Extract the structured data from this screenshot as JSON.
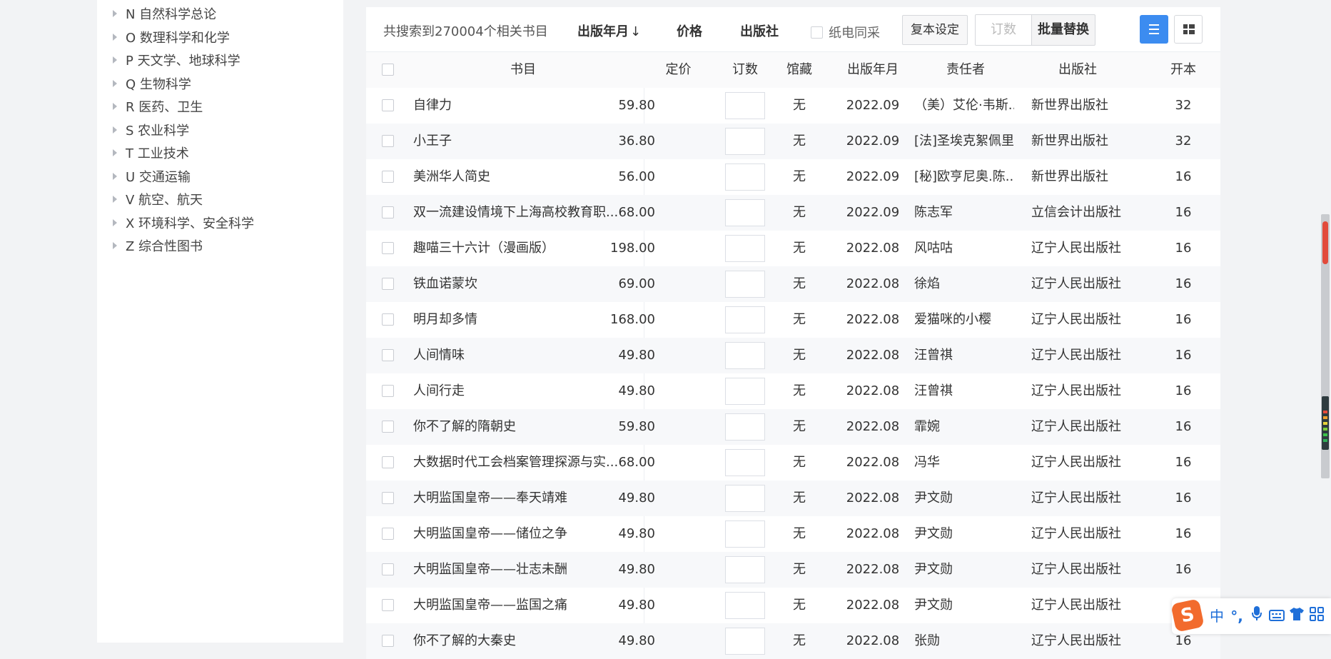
{
  "sidebar": {
    "items": [
      {
        "label": "N 自然科学总论"
      },
      {
        "label": "O 数理科学和化学"
      },
      {
        "label": "P 天文学、地球科学"
      },
      {
        "label": "Q 生物科学"
      },
      {
        "label": "R 医药、卫生"
      },
      {
        "label": "S 农业科学"
      },
      {
        "label": "T 工业技术"
      },
      {
        "label": "U 交通运输"
      },
      {
        "label": "V 航空、航天"
      },
      {
        "label": "X 环境科学、安全科学"
      },
      {
        "label": "Z 综合性图书"
      }
    ]
  },
  "toolbar": {
    "result_count": "共搜索到270004个相关书目",
    "sort_date": "出版年月",
    "sort_date_arrow": "↓",
    "sort_price": "价格",
    "sort_publisher": "出版社",
    "sync_label": "纸电同采",
    "copy_setting": "复本设定",
    "qty_placeholder": "订数",
    "batch_replace": "批量替换"
  },
  "table": {
    "headers": {
      "title": "书目",
      "price": "定价",
      "qty": "订数",
      "library": "馆藏",
      "date": "出版年月",
      "responsible": "责任者",
      "publisher": "出版社",
      "format": "开本"
    },
    "rows": [
      {
        "title": "自律力",
        "price": "59.80",
        "library": "无",
        "date": "2022.09",
        "responsible": "（美）艾伦·韦斯...",
        "publisher": "新世界出版社",
        "format": "32"
      },
      {
        "title": "小王子",
        "price": "36.80",
        "library": "无",
        "date": "2022.09",
        "responsible": "[法]圣埃克絮佩里",
        "publisher": "新世界出版社",
        "format": "32"
      },
      {
        "title": "美洲华人简史",
        "price": "56.00",
        "library": "无",
        "date": "2022.09",
        "responsible": "[秘]欧亨尼奥.陈...",
        "publisher": "新世界出版社",
        "format": "16"
      },
      {
        "title": "双一流建设情境下上海高校教育职...",
        "price": "68.00",
        "library": "无",
        "date": "2022.09",
        "responsible": "陈志军",
        "publisher": "立信会计出版社",
        "format": "16"
      },
      {
        "title": "趣喵三十六计（漫画版）",
        "price": "198.00",
        "library": "无",
        "date": "2022.08",
        "responsible": "风咕咕",
        "publisher": "辽宁人民出版社",
        "format": "16"
      },
      {
        "title": "铁血诺蒙坎",
        "price": "69.00",
        "library": "无",
        "date": "2022.08",
        "responsible": "徐焰",
        "publisher": "辽宁人民出版社",
        "format": "16"
      },
      {
        "title": "明月却多情",
        "price": "168.00",
        "library": "无",
        "date": "2022.08",
        "responsible": "爱猫咪的小樱",
        "publisher": "辽宁人民出版社",
        "format": "16"
      },
      {
        "title": "人间情味",
        "price": "49.80",
        "library": "无",
        "date": "2022.08",
        "responsible": "汪曾祺",
        "publisher": "辽宁人民出版社",
        "format": "16"
      },
      {
        "title": "人间行走",
        "price": "49.80",
        "library": "无",
        "date": "2022.08",
        "responsible": "汪曾祺",
        "publisher": "辽宁人民出版社",
        "format": "16"
      },
      {
        "title": "你不了解的隋朝史",
        "price": "59.80",
        "library": "无",
        "date": "2022.08",
        "responsible": "霏婉",
        "publisher": "辽宁人民出版社",
        "format": "16"
      },
      {
        "title": "大数据时代工会档案管理探源与实...",
        "price": "68.00",
        "library": "无",
        "date": "2022.08",
        "responsible": "冯华",
        "publisher": "辽宁人民出版社",
        "format": "16"
      },
      {
        "title": "大明监国皇帝——奉天靖难",
        "price": "49.80",
        "library": "无",
        "date": "2022.08",
        "responsible": "尹文勋",
        "publisher": "辽宁人民出版社",
        "format": "16"
      },
      {
        "title": "大明监国皇帝——储位之争",
        "price": "49.80",
        "library": "无",
        "date": "2022.08",
        "responsible": "尹文勋",
        "publisher": "辽宁人民出版社",
        "format": "16"
      },
      {
        "title": "大明监国皇帝——壮志未酬",
        "price": "49.80",
        "library": "无",
        "date": "2022.08",
        "responsible": "尹文勋",
        "publisher": "辽宁人民出版社",
        "format": "16"
      },
      {
        "title": "大明监国皇帝——监国之痛",
        "price": "49.80",
        "library": "无",
        "date": "2022.08",
        "responsible": "尹文勋",
        "publisher": "辽宁人民出版社",
        "format": "16"
      },
      {
        "title": "你不了解的大秦史",
        "price": "49.80",
        "library": "无",
        "date": "2022.08",
        "responsible": "张勋",
        "publisher": "辽宁人民出版社",
        "format": "16"
      }
    ]
  },
  "ime": {
    "logo": "S",
    "lang": "中",
    "punct": "°,",
    "icons": [
      "microphone-icon",
      "keyboard-icon",
      "shirt-icon",
      "grid-icon"
    ]
  },
  "colors": {
    "accent": "#3c8cf0",
    "ime_orange": "#f26b2d",
    "ime_blue": "#1f6fd8"
  }
}
